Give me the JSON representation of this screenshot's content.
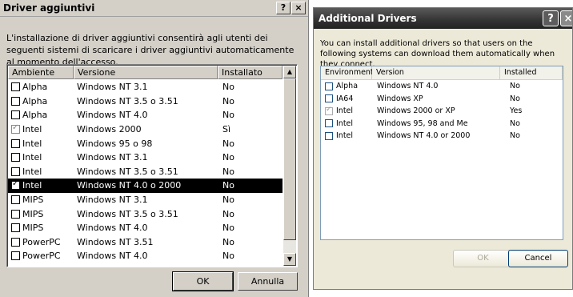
{
  "left_dialog": {
    "title": "Driver aggiuntivi",
    "help_label": "?",
    "close_label": "×",
    "description": "L'installazione di driver aggiuntivi consentirà agli utenti dei seguenti sistemi di scaricare i driver aggiuntivi automaticamente al momento dell'accesso.",
    "columns": [
      "Ambiente",
      "Versione",
      "Installato"
    ],
    "rows": [
      {
        "env": "Alpha",
        "version": "Windows NT 3.1",
        "installed": "No",
        "checked": false,
        "disabled": false
      },
      {
        "env": "Alpha",
        "version": "Windows NT 3.5 o 3.51",
        "installed": "No",
        "checked": false,
        "disabled": false
      },
      {
        "env": "Alpha",
        "version": "Windows NT 4.0",
        "installed": "No",
        "checked": false,
        "disabled": false
      },
      {
        "env": "Intel",
        "version": "Windows 2000",
        "installed": "Sì",
        "checked": true,
        "disabled": true
      },
      {
        "env": "Intel",
        "version": "Windows 95 o 98",
        "installed": "No",
        "checked": false,
        "disabled": false
      },
      {
        "env": "Intel",
        "version": "Windows NT 3.1",
        "installed": "No",
        "checked": false,
        "disabled": false
      },
      {
        "env": "Intel",
        "version": "Windows NT 3.5 o 3.51",
        "installed": "No",
        "checked": false,
        "disabled": false
      },
      {
        "env": "Intel",
        "version": "Windows NT 4.0 o 2000",
        "installed": "No",
        "checked": true,
        "disabled": false,
        "selected": true
      },
      {
        "env": "MIPS",
        "version": "Windows NT 3.1",
        "installed": "No",
        "checked": false,
        "disabled": false
      },
      {
        "env": "MIPS",
        "version": "Windows NT 3.5 o 3.51",
        "installed": "No",
        "checked": false,
        "disabled": false
      },
      {
        "env": "MIPS",
        "version": "Windows NT 4.0",
        "installed": "No",
        "checked": false,
        "disabled": false
      },
      {
        "env": "PowerPC",
        "version": "Windows NT 3.51",
        "installed": "No",
        "checked": false,
        "disabled": false
      },
      {
        "env": "PowerPC",
        "version": "Windows NT 4.0",
        "installed": "No",
        "checked": false,
        "disabled": false
      }
    ],
    "ok_label": "OK",
    "cancel_label": "Annulla"
  },
  "right_dialog": {
    "title": "Additional Drivers",
    "help_label": "?",
    "close_label": "×",
    "description": "You can install additional drivers so that users on the following systems can download them automatically when they connect.",
    "columns": [
      "Environment",
      "Version",
      "Installed"
    ],
    "rows": [
      {
        "env": "Alpha",
        "version": "Windows NT 4.0",
        "installed": "No",
        "checked": false,
        "disabled": false
      },
      {
        "env": "IA64",
        "version": "Windows XP",
        "installed": "No",
        "checked": false,
        "disabled": false
      },
      {
        "env": "Intel",
        "version": "Windows 2000 or XP",
        "installed": "Yes",
        "checked": true,
        "disabled": true
      },
      {
        "env": "Intel",
        "version": "Windows 95, 98 and Me",
        "installed": "No",
        "checked": false,
        "disabled": false
      },
      {
        "env": "Intel",
        "version": "Windows NT 4.0 or 2000",
        "installed": "No",
        "checked": false,
        "disabled": false
      }
    ],
    "ok_label": "OK",
    "cancel_label": "Cancel"
  },
  "colors": {
    "selection": "#000000",
    "classic_face": "#d4d0c8",
    "xp_face": "#ece9d8",
    "xp_titlebar": "#333333"
  }
}
